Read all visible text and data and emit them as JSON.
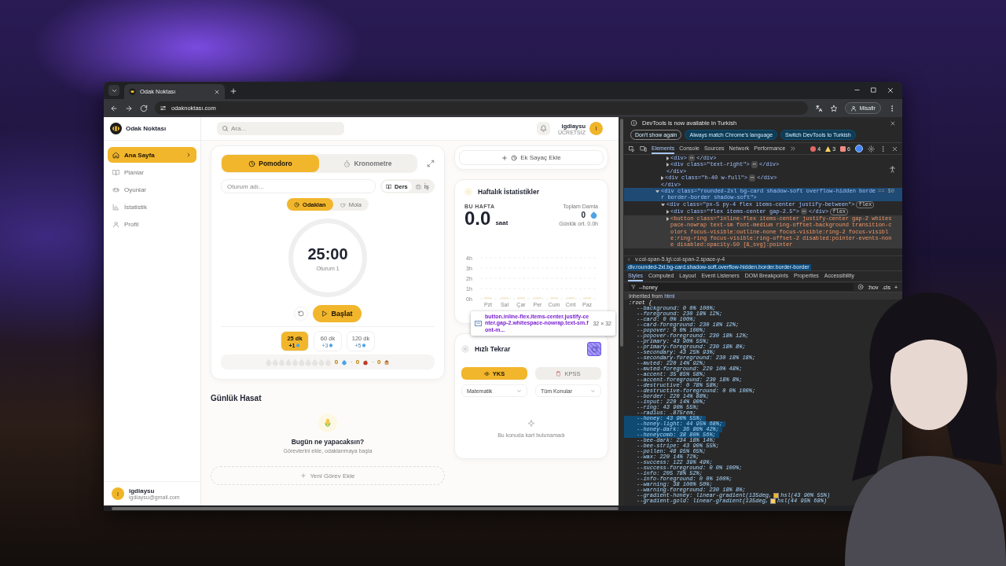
{
  "browser": {
    "tabs": [
      {
        "title": "Odak Noktası",
        "selected": true
      }
    ],
    "url": "odaknoktası.com",
    "profile": "Misafir"
  },
  "app": {
    "brand": "Odak Noktası",
    "nav": [
      {
        "label": "Ana Sayfa",
        "selected": true
      },
      {
        "label": "Planlar",
        "selected": false
      },
      {
        "label": "Oyunlar",
        "selected": false
      },
      {
        "label": "İstatistik",
        "selected": false
      },
      {
        "label": "Profil",
        "selected": false
      }
    ],
    "user": {
      "initial": "I",
      "name": "igdiaysu",
      "email": "igdiaysu@gmail.com"
    },
    "header": {
      "search_placeholder": "Ara...",
      "user_name": "igdiaysu",
      "plan": "ÜCRETSİZ",
      "initial": "I"
    },
    "timer": {
      "modes": [
        {
          "label": "Pomodoro",
          "selected": true
        },
        {
          "label": "Kronometre",
          "selected": false
        }
      ],
      "session_placeholder": "Oturum adı...",
      "categories": [
        {
          "label": "Ders",
          "selected": true
        },
        {
          "label": "İş",
          "selected": false
        }
      ],
      "phases": [
        {
          "label": "Odaklan",
          "selected": true
        },
        {
          "label": "Mola",
          "selected": false
        }
      ],
      "time": "25:00",
      "session": "Oturum 1",
      "start": "Başlat",
      "durations": [
        {
          "label": "25 dk",
          "reward": "+1",
          "selected": true
        },
        {
          "label": "60 dk",
          "reward": "+3",
          "selected": false
        },
        {
          "label": "120 dk",
          "reward": "+5",
          "selected": false
        }
      ],
      "counters": [
        {
          "value": "0",
          "kind": "drop"
        },
        {
          "value": "0",
          "kind": "apple"
        },
        {
          "value": "0",
          "kind": "house"
        }
      ],
      "separators": [
        "·",
        "·"
      ]
    },
    "harvest": {
      "title": "Günlük Hasat",
      "empty_title": "Bugün ne yapacaksın?",
      "empty_text": "Görevlerini ekle, odaklanmaya başla",
      "add_button": "Yeni Görev Ekle"
    },
    "extra_timer_button": "Ek Sayaç Ekle",
    "weekly": {
      "title": "Haftalık İstatistikler",
      "period": "BU HAFTA",
      "hours": "0.0",
      "unit": "saat",
      "total_label": "Toplam Damla",
      "total": "0",
      "daily_avg": "Günlük ort. 0.0h",
      "chart_data": {
        "type": "bar",
        "grid": true,
        "categories": [
          "Pzt",
          "Sal",
          "Çar",
          "Per",
          "Cum",
          "Cmt",
          "Paz"
        ],
        "values": [
          0,
          0,
          0,
          0,
          0,
          0,
          0
        ],
        "ylim": [
          0,
          4
        ],
        "yticks": [
          {
            "value": 0,
            "label": "0h"
          },
          {
            "value": 1,
            "label": "1h"
          },
          {
            "value": 2,
            "label": "2h"
          },
          {
            "value": 3,
            "label": "3h"
          },
          {
            "value": 4,
            "label": "4h"
          }
        ]
      }
    },
    "review": {
      "title": "Hızlı Tekrar",
      "exams": [
        {
          "label": "YKS",
          "selected": true
        },
        {
          "label": "KPSS",
          "selected": false
        }
      ],
      "subject": "Matematik",
      "topic": "Tüm Konular",
      "empty": "Bu konuda kart bulunamadı"
    }
  },
  "inspect_tooltip": {
    "selector": "button.inline-flex.items-center.justify-center.gap-2.whitespace-nowrap.text-sm.font-m...",
    "size": "32 × 32"
  },
  "devtools": {
    "banner": {
      "text": "DevTools is now available in Turkish",
      "buttons": [
        "Don't show again",
        "Always match Chrome's language",
        "Switch DevTools to Turkish"
      ]
    },
    "tabs": [
      {
        "label": "Elements",
        "selected": true
      },
      {
        "label": "Console",
        "selected": false
      },
      {
        "label": "Sources",
        "selected": false
      },
      {
        "label": "Network",
        "selected": false
      },
      {
        "label": "Performance",
        "selected": false
      }
    ],
    "errors": "4",
    "warnings": "3",
    "issues": "6",
    "dom_tree": [
      {
        "kind": "group",
        "children": [
          {
            "kind": "group",
            "children": [
              {
                "kind": "element",
                "text": "<div>",
                "more": "⋯",
                "tail": "</div>",
                "expanded": false,
                "selected": false,
                "hovered": false
              },
              {
                "kind": "element",
                "text": "<div class=\"text-right\">",
                "more": "⋯",
                "tail": "</div>",
                "expanded": false,
                "selected": false,
                "hovered": false
              }
            ]
          },
          {
            "kind": "close",
            "text": "</div>"
          },
          {
            "kind": "element",
            "text": "<div class=\"h-40 w-full\">",
            "more": "⋯",
            "tail": "</div>",
            "expanded": false,
            "selected": false,
            "hovered": false
          }
        ]
      },
      {
        "kind": "close",
        "text": "</div>"
      },
      {
        "kind": "element",
        "text": "<div class=\"rounded-2xl bg-card shadow-soft overflow-hidden border border-border shadow-soft\">",
        "suffix": "== $0",
        "expanded": true,
        "selected": true,
        "hovered": false,
        "children": [
          {
            "kind": "element",
            "text": "<div class=\"px-5 py-4 flex items-center justify-between\">",
            "badge": "flex",
            "expanded": true,
            "selected": false,
            "hovered": false,
            "children": [
              {
                "kind": "element",
                "text": "<div class=\"flex items-center gap-2.5\">",
                "more": "⋯",
                "tail": "</div>",
                "badge": "flex",
                "expanded": false,
                "selected": false,
                "hovered": false
              },
              {
                "kind": "element",
                "text": "<button class=\"inline-flex items-center justify-center gap-2 whitespace-nowrap text-sm font-medium ring-offset-background transition-colors focus-visible:outline-none focus-visible:ring-2 focus-visible:ring-ring focus-visible:ring-offset-2 disabled:pointer-events-none disabled:opacity-50 [&_svg]:pointer",
                "expanded": false,
                "selected": false,
                "hovered": true
              }
            ]
          }
        ]
      }
    ],
    "breadcrumbs": [
      {
        "text": "v.col-span-5.lg\\:col-span-2.space-y-4",
        "selected": false
      },
      {
        "text": "div.rounded-2xl.bg-card.shadow-soft.overflow-hidden.border.border-border",
        "selected": true
      }
    ],
    "style_tabs": [
      {
        "label": "Styles",
        "selected": true
      },
      {
        "label": "Computed",
        "selected": false
      },
      {
        "label": "Layout",
        "selected": false
      },
      {
        "label": "Event Listeners",
        "selected": false
      },
      {
        "label": "DOM Breakpoints",
        "selected": false
      },
      {
        "label": "Properties",
        "selected": false
      },
      {
        "label": "Accessibility",
        "selected": false
      }
    ],
    "filter": "--honey",
    "hov": ":hov",
    "cls": ".cls",
    "add": "+",
    "inherited_label": "Inherited from",
    "inherited_from": "html",
    "selector": ":root {",
    "properties": [
      {
        "text": "--background: 0 0% 100%;",
        "highlighted": false
      },
      {
        "text": "--foreground: 230 18% 12%;",
        "highlighted": false
      },
      {
        "text": "--card: 0 0% 100%;",
        "highlighted": false
      },
      {
        "text": "--card-foreground: 230 18% 12%;",
        "highlighted": false
      },
      {
        "text": "--popover: 0 0% 100%;",
        "highlighted": false
      },
      {
        "text": "--popover-foreground: 230 18% 12%;",
        "highlighted": false
      },
      {
        "text": "--primary: 43 90% 55%;",
        "highlighted": false
      },
      {
        "text": "--primary-foreground: 230 18% 8%;",
        "highlighted": false
      },
      {
        "text": "--secondary: 43 25% 93%;",
        "highlighted": false
      },
      {
        "text": "--secondary-foreground: 230 18% 18%;",
        "highlighted": false
      },
      {
        "text": "--muted: 220 14% 92%;",
        "highlighted": false
      },
      {
        "text": "--muted-foreground: 220 10% 48%;",
        "highlighted": false
      },
      {
        "text": "--accent: 35 85% 58%;",
        "highlighted": false
      },
      {
        "text": "--accent-foreground: 230 18% 8%;",
        "highlighted": false
      },
      {
        "text": "--destructive: 0 78% 58%;",
        "highlighted": false
      },
      {
        "text": "--destructive-foreground: 0 0% 100%;",
        "highlighted": false
      },
      {
        "text": "--border: 220 14% 88%;",
        "highlighted": false
      },
      {
        "text": "--input: 220 14% 90%;",
        "highlighted": false
      },
      {
        "text": "--ring: 43 90% 55%;",
        "highlighted": false
      },
      {
        "text": "--radius: .875rem;",
        "highlighted": false
      },
      {
        "text": "--honey: 43 90% 55%;",
        "highlighted": true
      },
      {
        "text": "--honey-light: 44 95% 68%;",
        "highlighted": true
      },
      {
        "text": "--honey-dark: 36 80% 42%;",
        "highlighted": true
      },
      {
        "text": "--honeycomb: 38 80% 56%;",
        "highlighted": true
      },
      {
        "text": "--bee-dark: 234 18% 14%;",
        "highlighted": false
      },
      {
        "text": "--bee-stripe: 43 90% 55%;",
        "highlighted": false
      },
      {
        "text": "--pollen: 48 95% 65%;",
        "highlighted": false
      },
      {
        "text": "--wax: 220 14% 72%;",
        "highlighted": false
      },
      {
        "text": "--success: 122 39% 49%;",
        "highlighted": false
      },
      {
        "text": "--success-foreground: 0 0% 100%;",
        "highlighted": false
      },
      {
        "text": "--info: 205 78% 52%;",
        "highlighted": false
      },
      {
        "text": "--info-foreground: 0 0% 100%;",
        "highlighted": false
      },
      {
        "text": "--warning: 38 100% 50%;",
        "highlighted": false
      },
      {
        "text": "--warning-foreground: 230 18% 8%;",
        "highlighted": false
      },
      {
        "text": "--gradient-honey: linear-gradient(135deg,",
        "color": "#f3b925",
        "rest": "hsl(43 90% 55%)",
        "highlighted": false
      },
      {
        "text": "--gradient-gold: linear-gradient(135deg,",
        "color": "#fbd260",
        "rest": "hsl(44 95% 68%)",
        "highlighted": false
      }
    ]
  }
}
